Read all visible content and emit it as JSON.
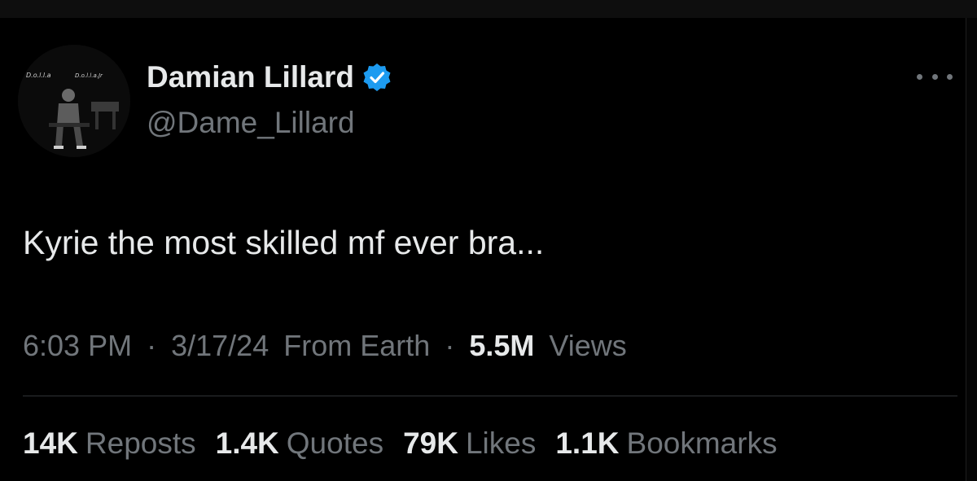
{
  "author": {
    "name": "Damian Lillard",
    "handle": "@Dame_Lillard",
    "verified_color": "#1d9bf0",
    "avatar_text_left": "D.o.l.l.a",
    "avatar_text_right": "D.o.l.l.a.Jr"
  },
  "tweet": {
    "text": "Kyrie the most skilled mf ever bra..."
  },
  "meta": {
    "time": "6:03 PM",
    "separator": "·",
    "date": "3/17/24",
    "source": "From Earth",
    "views_count": "5.5M",
    "views_label": "Views"
  },
  "stats": [
    {
      "count": "14K",
      "label": "Reposts"
    },
    {
      "count": "1.4K",
      "label": "Quotes"
    },
    {
      "count": "79K",
      "label": "Likes"
    },
    {
      "count": "1.1K",
      "label": "Bookmarks"
    }
  ],
  "icons": {
    "verified": "verified-badge-icon",
    "more": "more-options-icon"
  }
}
